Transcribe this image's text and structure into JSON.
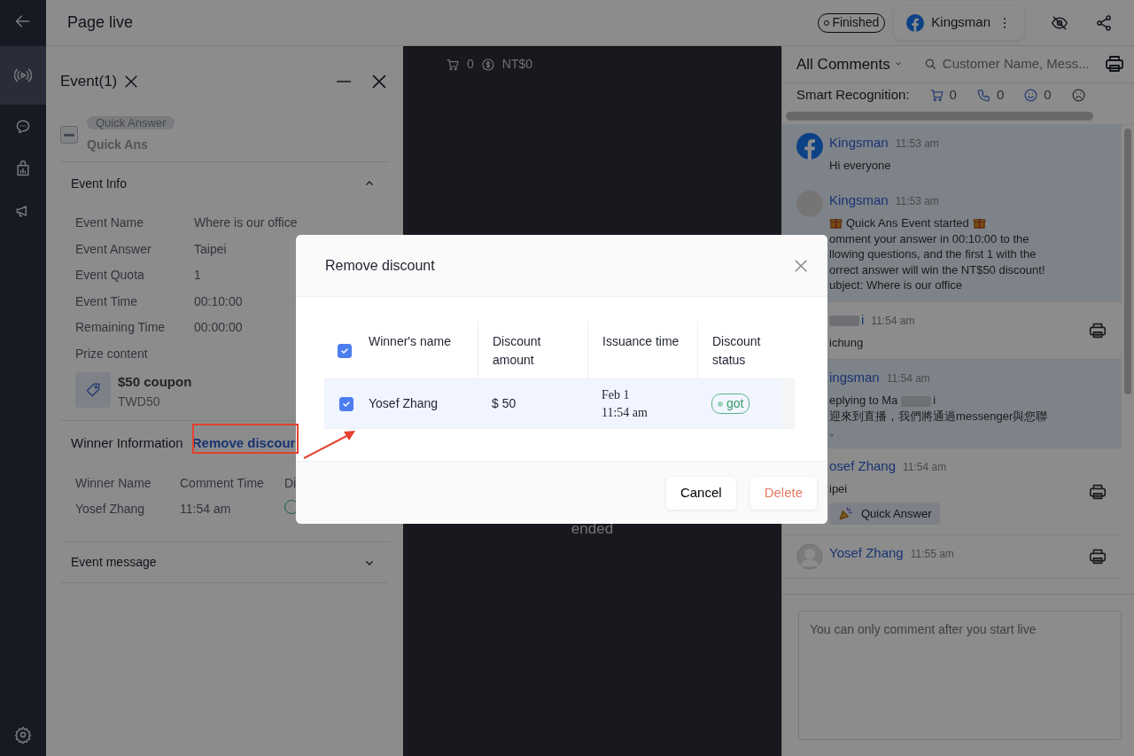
{
  "header": {
    "title": "Page live",
    "status": "Finished",
    "account": "Kingsman"
  },
  "sidebar": {
    "items": [
      {
        "kind": "back",
        "selected": false
      },
      {
        "kind": "live",
        "selected": true
      },
      {
        "kind": "chat",
        "selected": false
      },
      {
        "kind": "shop",
        "selected": false
      },
      {
        "kind": "megaphone",
        "selected": false
      },
      {
        "kind": "settings",
        "selected": false
      }
    ]
  },
  "event_panel": {
    "tab": "Event(1)",
    "quick_answer": {
      "badge": "Quick Answer",
      "title": "Quick Ans",
      "indeterminate": true
    },
    "event_info": {
      "title": "Event Info",
      "expanded": true,
      "rows": [
        {
          "label": "Event Name",
          "value": "Where is our office"
        },
        {
          "label": "Event Answer",
          "value": "Taipei"
        },
        {
          "label": "Event Quota",
          "value": "1"
        },
        {
          "label": "Event Time",
          "value": "00:10:00"
        },
        {
          "label": "Remaining Time",
          "value": "00:00:00"
        }
      ],
      "prize_label": "Prize content",
      "prize": {
        "title": "$50 coupon",
        "code": "TWD50"
      }
    },
    "winner_info": {
      "title": "Winner Information",
      "link": "Remove discour",
      "columns": [
        "Winner Name",
        "Comment Time",
        "Di"
      ],
      "rows": [
        [
          "Yosef Zhang",
          "11:54 am"
        ]
      ]
    },
    "event_message": {
      "title": "Event message",
      "expanded": false
    }
  },
  "video": {
    "cart_count": "0",
    "sales": "NT$0",
    "status": "ended"
  },
  "comments": {
    "filter": "All Comments",
    "search": {
      "placeholder": "Customer Name, Mess..."
    },
    "smart_recognition": {
      "label": "Smart Recognition:",
      "counts": [
        {
          "kind": "cart",
          "count": "0"
        },
        {
          "kind": "call",
          "count": "0"
        },
        {
          "kind": "happy",
          "count": "0"
        },
        {
          "kind": "sad"
        }
      ]
    },
    "items": [
      {
        "kind": "facebook",
        "author": "Kingsman",
        "time": "11:53 am",
        "lines": [
          "Hi everyone"
        ],
        "highlighted": true,
        "printable": false
      },
      {
        "kind": "logo",
        "author": "Kingsman",
        "time": "11:53 am",
        "gift_icons": true,
        "lines": [
          "Quick Ans Event started",
          "omment your answer in 00:10:00 to the",
          "llowing questions, and the first 1 with the",
          "orrect answer will win the NT$50 discount!",
          "ubject: Where is our office"
        ],
        "highlighted": true,
        "printable": false
      },
      {
        "author": "i",
        "redacted": true,
        "time": "11:54 am",
        "lines": [
          "ichung"
        ],
        "highlighted": false,
        "printable": true
      },
      {
        "author": "ingsman",
        "time": "11:54 am",
        "reply_to": {
          "prefix": "eplying to Ma",
          "suffix": "i"
        },
        "lines": [
          "迎來到直播，我們將通過messenger與您聯",
          "。"
        ],
        "highlighted": true,
        "printable": false
      },
      {
        "author": "osef Zhang",
        "time": "11:54 am",
        "lines": [
          "ipei"
        ],
        "tag": "Quick Answer",
        "highlighted": false,
        "printable": true
      },
      {
        "kind": "silhouette",
        "author": "Yosef Zhang",
        "time": "11:55 am",
        "highlighted": false,
        "printable": true
      }
    ],
    "composer": {
      "placeholder": "You can only comment after you start live"
    }
  },
  "modal": {
    "title": "Remove discount",
    "all_checked": true,
    "columns": [
      "Winner's name",
      "Discount amount",
      "Issuance time",
      "Discount status"
    ],
    "rows": [
      {
        "checked": true,
        "selected": true,
        "name": "Yosef Zhang",
        "amount": "$ 50",
        "issued": [
          "Feb 1",
          "11:54 am"
        ],
        "status": "got"
      }
    ],
    "buttons": [
      {
        "label": "Cancel",
        "kind": "default"
      },
      {
        "label": "Delete",
        "kind": "danger"
      }
    ]
  }
}
